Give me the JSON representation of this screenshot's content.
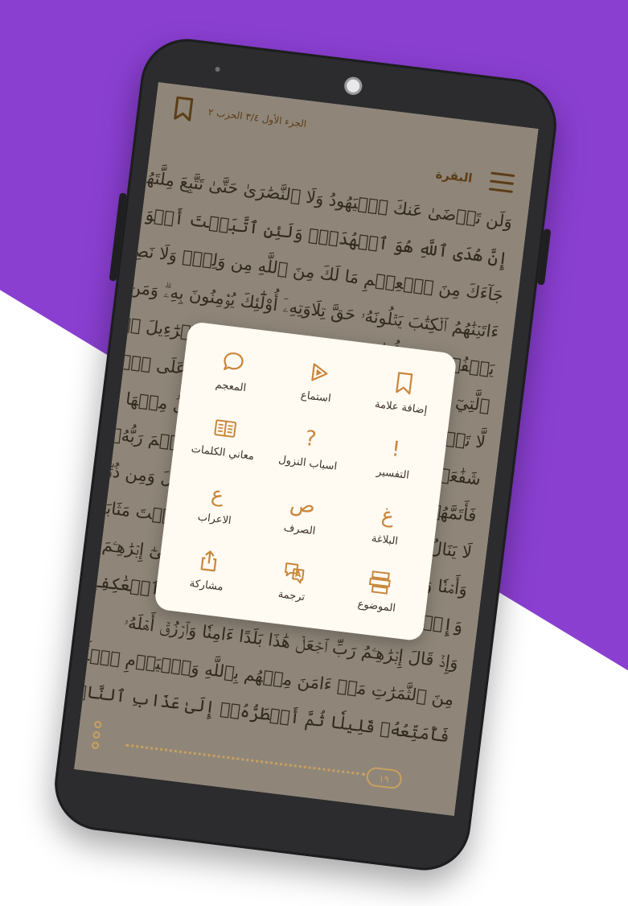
{
  "header": {
    "page_info": "الجزء الأول ٣/٤ الحزب ٢",
    "surah_name": "البقرة"
  },
  "quran_lines": [
    "وَلَن تَرۡضَىٰ عَنكَ ٱلۡيَهُودُ وَلَا ٱلنَّصَٰرَىٰ حَتَّىٰ تَتَّبِعَ مِلَّتَهُمۡۗ قُلۡ",
    "إِنَّ هُدَى ٱللَّهِ هُوَ ٱلۡهُدَىٰۗ وَلَئِنِ ٱتَّبَعۡتَ أَهۡوَآءَهُم بَعۡدَ ٱلَّذِي",
    "جَآءَكَ مِنَ ٱلۡعِلۡمِ مَا لَكَ مِنَ ٱللَّهِ مِن وَلِيّٖ وَلَا نَصِيرٍ ١٢٠ ٱلَّذِينَ",
    "ءَاتَيۡنَٰهُمُ ٱلۡكِتَٰبَ يَتۡلُونَهُۥ حَقَّ تِلَاوَتِهِۦٓ أُوْلَٰٓئِكَ يُؤۡمِنُونَ بِهِۦۗ وَمَن",
    "يَكۡفُرۡ بِهِۦ فَأُوْلَٰٓئِكَ هُمُ ٱلۡخَٰسِرُونَ يَٰبَنِيٓ إِسۡرَٰٓءِيلَ ٱذۡكُرُواْ نِعۡمَتِيَ",
    "ٱلَّتِيٓ أَنۡعَمۡتُ عَلَيۡكُمۡ وَأَنِّي فَضَّلۡتُكُمۡ عَلَى ٱلۡعَٰلَمِينَ وَٱتَّقُواْ يَوۡمٗا",
    "لَّا تَجۡزِي نَفۡسٌ عَن نَّفۡسٖ شَيۡـٔٗا وَلَا يُقۡبَلُ مِنۡهَا عَدۡلٞ وَلَا تَنفَعُهَا",
    "شَفَٰعَةٞ وَلَا هُمۡ يُنصَرُونَ وَإِذِ ٱبۡتَلَىٰٓ إِبۡرَٰهِـۧمَ رَبُّهُۥ بِكَلِمَٰتٖ",
    "فَأَتَمَّهُنَّۖ قَالَ إِنِّي جَاعِلُكَ لِلنَّاسِ إِمَامٗاۖ قَالَ وَمِن ذُرِّيَّتِيۖ قَالَ",
    "لَا يَنَالُ عَهۡدِي ٱلظَّٰلِمِينَ وَإِذۡ جَعَلۡنَا ٱلۡبَيۡتَ مَثَابَةٗ لِّلنَّاسِ",
    "وَأَمۡنٗا وَٱتَّخِذُواْ مِن مَّقَامِ إِبۡرَٰهِـۧمَ مُصَلّٗىۖ وَعَهِدۡنَآ إِلَىٰٓ إِبۡرَٰهِـۧمَ",
    "وَإِسۡمَٰعِيلَ أَن طَهِّرَا بَيۡتِيَ لِلطَّآئِفِينَ وَٱلۡعَٰكِفِينَ وَٱلرُّكَّعِ ٱلسُّجُودِ",
    "وَإِذۡ قَالَ إِبۡرَٰهِـۧمُ رَبِّ ٱجۡعَلۡ هَٰذَا بَلَدًا ءَامِنٗا وَٱرۡزُقۡ أَهۡلَهُۥ",
    "مِنَ ٱلثَّمَرَٰتِ مَنۡ ءَامَنَ مِنۡهُم بِٱللَّهِ وَٱلۡيَوۡمِ ٱلۡأٓخِرِۚ قَالَ وَمَن كَفَرَ",
    "فَأُمَتِّعُهُۥ قَلِيلٗا ثُمَّ أَضۡطَرُّهُۥٓ إِلَىٰ عَذَابِ ٱلنَّارِۖ وَبِئۡسَ ٱلۡمَصِيرُ"
  ],
  "page_number": "١٩",
  "actions": [
    {
      "label": "المعجم",
      "icon": "chat-bubble-icon"
    },
    {
      "label": "استماع",
      "icon": "play-icon"
    },
    {
      "label": "إضافة علامة",
      "icon": "bookmark-icon"
    },
    {
      "label": "معاني الكلمات",
      "icon": "book-icon"
    },
    {
      "label": "اسباب النزول",
      "icon": "question-icon",
      "glyph": "?"
    },
    {
      "label": "التفسير",
      "icon": "exclamation-icon",
      "glyph": "!"
    },
    {
      "label": "الاعراب",
      "icon": "ain-letter-icon",
      "glyph": "ع"
    },
    {
      "label": "الصرف",
      "icon": "sad-letter-icon",
      "glyph": "ص"
    },
    {
      "label": "البلاغة",
      "icon": "ghain-letter-icon",
      "glyph": "غ"
    },
    {
      "label": "مشاركة",
      "icon": "share-icon"
    },
    {
      "label": "ترجمة",
      "icon": "translate-icon"
    },
    {
      "label": "الموضوع",
      "icon": "topic-icon"
    }
  ],
  "colors": {
    "background_purple": "#8a3fd1",
    "accent_gold": "#c8863a",
    "page_paper": "#eee6d5"
  }
}
